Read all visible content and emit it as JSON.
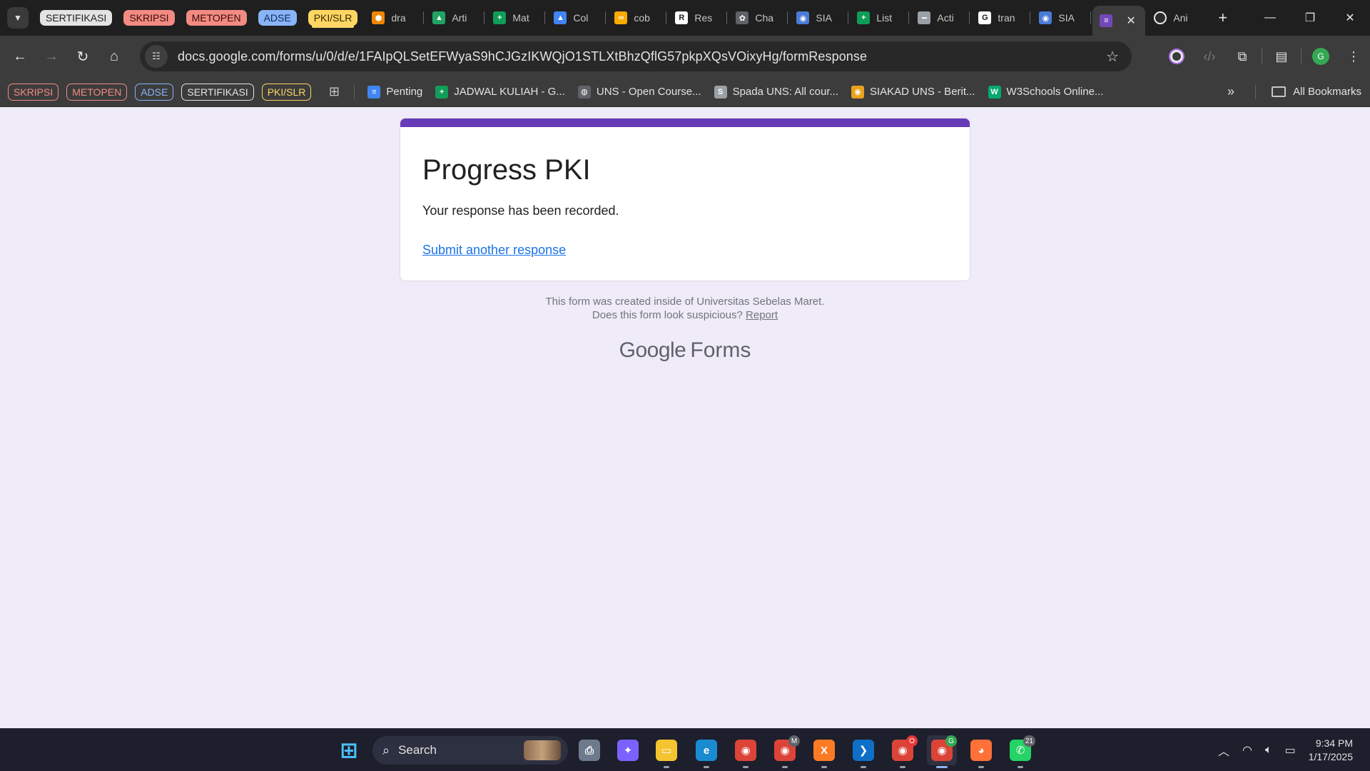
{
  "tab_groups": [
    {
      "label": "SERTIFIKASI",
      "color": "#e3e3e3",
      "text": "#1f1f1f"
    },
    {
      "label": "SKRIPSI",
      "color": "#f28b82",
      "text": "#3c0a0a"
    },
    {
      "label": "METOPEN",
      "color": "#f28b82",
      "text": "#3c0a0a"
    },
    {
      "label": "ADSE",
      "color": "#8ab4f8",
      "text": "#0b2a5a"
    },
    {
      "label": "PKI/SLR",
      "color": "#fdd663",
      "text": "#3a2a00"
    }
  ],
  "tabs": [
    {
      "label": "dra",
      "icon": "drawio-icon",
      "color": "#f08705",
      "glyph": "⬢"
    },
    {
      "label": "Arti",
      "icon": "google-drive-icon",
      "color": "#1fa463",
      "glyph": "▲"
    },
    {
      "label": "Mat",
      "icon": "google-sheets-icon",
      "color": "#0f9d58",
      "glyph": "+"
    },
    {
      "label": "Col",
      "icon": "google-drive-icon",
      "color": "#4285f4",
      "glyph": "▲"
    },
    {
      "label": "cob",
      "icon": "colab-icon",
      "color": "#f9ab00",
      "glyph": "∞"
    },
    {
      "label": "Res",
      "icon": "researchgate-icon",
      "color": "#ffffff",
      "glyph": "R"
    },
    {
      "label": "Cha",
      "icon": "chatgpt-icon",
      "color": "#5f6368",
      "glyph": "✿"
    },
    {
      "label": "SIA",
      "icon": "siakad-icon",
      "color": "#4a7bd6",
      "glyph": "◉"
    },
    {
      "label": "List",
      "icon": "google-sheets-icon",
      "color": "#0f9d58",
      "glyph": "+"
    },
    {
      "label": "Acti",
      "icon": "activity-icon",
      "color": "#9aa0a6",
      "glyph": "━"
    },
    {
      "label": "tran",
      "icon": "google-icon",
      "color": "#ffffff",
      "glyph": "G"
    },
    {
      "label": "SIA",
      "icon": "siakad-icon",
      "color": "#4a7bd6",
      "glyph": "◉"
    }
  ],
  "active_tab": {
    "icon": "google-forms-icon",
    "color": "#7248b9",
    "glyph": "≡",
    "close": "✕"
  },
  "after_tab": {
    "label": "Ani",
    "icon": "anime-icon",
    "color": "#e8eaed",
    "glyph": "◎"
  },
  "toolbar": {
    "url": "docs.google.com/forms/u/0/d/e/1FAIpQLSetEFWyaS9hCJGzIKWQjO1STLXtBhzQflG57pkpXQsVOixyHg/formResponse",
    "avatar": "G"
  },
  "bookmark_groups": [
    {
      "label": "SKRIPSI",
      "color": "#f28b82"
    },
    {
      "label": "METOPEN",
      "color": "#f28b82"
    },
    {
      "label": "ADSE",
      "color": "#8ab4f8"
    },
    {
      "label": "SERTIFIKASI",
      "color": "#e3e3e3"
    },
    {
      "label": "PKI/SLR",
      "color": "#fdd663"
    }
  ],
  "bookmarks": [
    {
      "label": "Penting",
      "icon": "google-docs-icon",
      "color": "#4285f4",
      "glyph": "≡"
    },
    {
      "label": "JADWAL KULIAH - G...",
      "icon": "google-sheets-icon",
      "color": "#0f9d58",
      "glyph": "+"
    },
    {
      "label": "UNS - Open Course...",
      "icon": "globe-icon",
      "color": "#5f6368",
      "glyph": "◍"
    },
    {
      "label": "Spada UNS: All cour...",
      "icon": "spada-icon",
      "color": "#9aa0a6",
      "glyph": "S"
    },
    {
      "label": "SIAKAD UNS - Berit...",
      "icon": "siakad-icon",
      "color": "#e8a11a",
      "glyph": "◉"
    },
    {
      "label": "W3Schools Online...",
      "icon": "w3schools-icon",
      "color": "#04aa6d",
      "glyph": "W"
    }
  ],
  "all_bookmarks": "All Bookmarks",
  "form": {
    "title": "Progress PKI",
    "message": "Your response has been recorded.",
    "link": "Submit another response",
    "accent": "#673ab7"
  },
  "footer": {
    "line1": "This form was created inside of Universitas Sebelas Maret.",
    "line2": "Does this form look suspicious?",
    "report": "Report",
    "logo_google": "Google",
    "logo_forms": "Forms"
  },
  "taskbar": {
    "search": "Search",
    "time": "9:34 PM",
    "date": "1/17/2025",
    "apps": [
      {
        "name": "start-button",
        "color": "#3b8ff6",
        "glyph": "⊞"
      },
      {
        "name": "printer-app",
        "color": "#6c7a8c",
        "glyph": "⎙"
      },
      {
        "name": "copilot-app",
        "color": "#7b61ff",
        "glyph": "✦"
      },
      {
        "name": "file-explorer-app",
        "color": "#f4c431",
        "glyph": "▭"
      },
      {
        "name": "edge-app",
        "color": "#1a8bd1",
        "glyph": "e"
      },
      {
        "name": "chrome-app",
        "color": "#db4437",
        "glyph": "◉"
      },
      {
        "name": "chrome-profile-m-app",
        "color": "#db4437",
        "glyph": "◉",
        "badge": "M",
        "badge_color": "#5f6368"
      },
      {
        "name": "xampp-app",
        "color": "#fb7a24",
        "glyph": "X"
      },
      {
        "name": "vscode-app",
        "color": "#0f6fc6",
        "glyph": "❯"
      },
      {
        "name": "chrome-profile-o-app",
        "color": "#db4437",
        "glyph": "◉",
        "badge": "O",
        "badge_color": "#e53935"
      },
      {
        "name": "chrome-profile-g-app",
        "color": "#db4437",
        "glyph": "◉",
        "badge": "G",
        "badge_color": "#34a853",
        "active": true
      },
      {
        "name": "firefox-app",
        "color": "#ff7139",
        "glyph": "◕"
      },
      {
        "name": "whatsapp-app",
        "color": "#25d366",
        "glyph": "✆",
        "badge": "21",
        "badge_color": "#5f6368"
      }
    ]
  }
}
